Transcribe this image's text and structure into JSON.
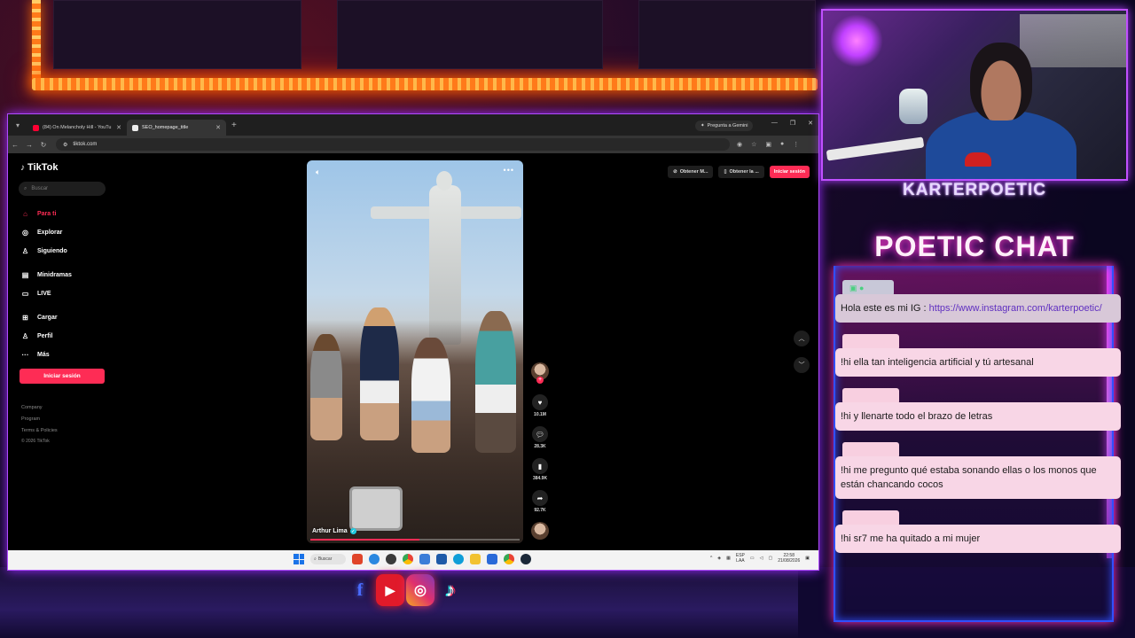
{
  "browser": {
    "tabs": [
      {
        "label": "(84) On Melancholy Hill - YouTu",
        "active": false
      },
      {
        "label": "SEO_homepage_title",
        "active": true
      }
    ],
    "gemini_label": "Pregunta a Gemini",
    "url": "tiktok.com"
  },
  "tiktok": {
    "logo": "TikTok",
    "search_placeholder": "Buscar",
    "nav": [
      {
        "label": "Para ti",
        "icon": "home-icon",
        "active": true
      },
      {
        "label": "Explorar",
        "icon": "compass-icon"
      },
      {
        "label": "Siguiendo",
        "icon": "following-icon"
      },
      {
        "label": "Minidramas",
        "icon": "minidramas-icon"
      },
      {
        "label": "LIVE",
        "icon": "live-icon"
      },
      {
        "label": "Cargar",
        "icon": "upload-icon"
      },
      {
        "label": "Perfil",
        "icon": "profile-icon"
      },
      {
        "label": "Más",
        "icon": "more-icon"
      }
    ],
    "login_label": "Iniciar sesión",
    "footer": [
      "Company",
      "Program",
      "Terms & Policies"
    ],
    "copyright": "© 2026 TikTok",
    "top_actions": [
      "Obtener M...",
      "Obtener la ...",
      "Iniciar sesión"
    ],
    "video": {
      "author": "Arthur Lima",
      "progress": 0.52
    },
    "counts": {
      "likes": "10.1M",
      "comments": "28.3K",
      "saves": "384.9K",
      "shares": "92.7K"
    }
  },
  "taskbar": {
    "search_label": "Buscar",
    "lang_1": "ESP",
    "lang_2": "LAA",
    "time": "22:58",
    "date": "21/08/2026"
  },
  "overlay": {
    "streamer_name": "KARTERPOETIC",
    "chat_title": "POETIC CHAT"
  },
  "chat": [
    {
      "prefix": "Hola este es mi IG : ",
      "link": "https://www.instagram.com/karterpoetic/"
    },
    {
      "text": "!hi ella tan inteligencia artificial y tú artesanal"
    },
    {
      "text": "!hi y llenarte todo el brazo de letras"
    },
    {
      "text": "!hi me pregunto qué estaba sonando ellas o los monos que están chancando cocos"
    },
    {
      "text": "!hi sr7 me ha quitado a mi mujer"
    }
  ],
  "colors": {
    "tiktok_red": "#fe2c55",
    "neon_purple": "#b040ff",
    "chat_pink": "#f8d6e6"
  }
}
